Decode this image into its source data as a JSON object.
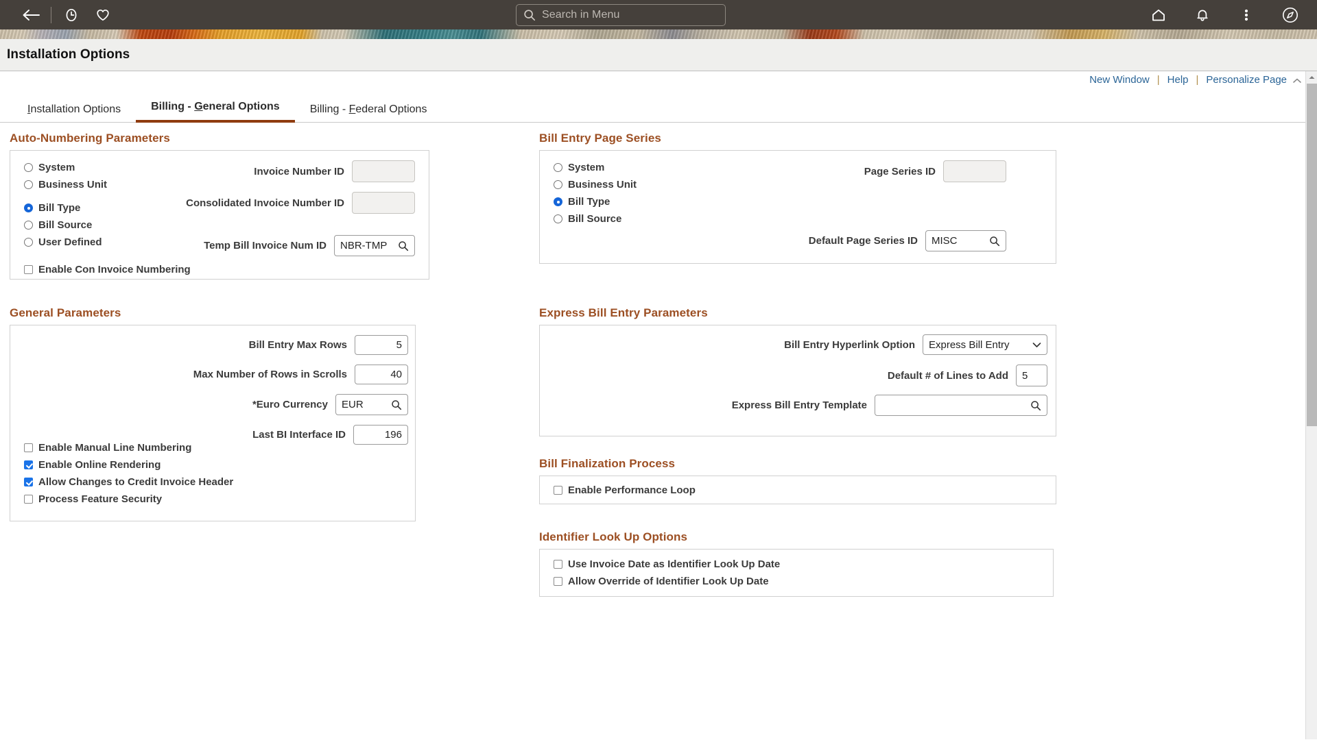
{
  "topbar": {
    "back_icon": "back-arrow-icon",
    "recent_icon": "clock-icon",
    "favorites_icon": "heart-icon",
    "home_icon": "home-icon",
    "notifications_icon": "bell-icon",
    "actions_icon": "kebab-menu-icon",
    "navbar_icon": "compass-icon",
    "search": {
      "placeholder": "Search in Menu",
      "value": "",
      "icon": "search-icon"
    },
    "background_color": "#45403b"
  },
  "page": {
    "title": "Installation Options"
  },
  "toolbar_links": {
    "new_window": "New Window",
    "help": "Help",
    "personalize": "Personalize Page",
    "separator": "|",
    "collapse_icon": "collapse-up-icon",
    "link_color": "#2a6496"
  },
  "tabs": [
    {
      "label": "Installation Options",
      "accel": "I",
      "active": false
    },
    {
      "label": "Billing - General Options",
      "accel": "G",
      "active": true
    },
    {
      "label": "Billing - Federal Options",
      "accel": "F",
      "active": false
    }
  ],
  "accent_color": "#9c4f23",
  "sections": {
    "auto_numbering": {
      "title": "Auto-Numbering Parameters",
      "radios": [
        {
          "label": "System",
          "checked": false
        },
        {
          "label": "Business Unit",
          "checked": false
        },
        {
          "label": "Bill Type",
          "checked": true
        },
        {
          "label": "Bill Source",
          "checked": false
        },
        {
          "label": "User Defined",
          "checked": false
        }
      ],
      "checkbox": {
        "label": "Enable Con Invoice Numbering",
        "checked": false
      },
      "fields": [
        {
          "label": "Invoice Number ID",
          "value": "",
          "disabled": true,
          "lookup": false
        },
        {
          "label": "Consolidated Invoice Number ID",
          "value": "",
          "disabled": true,
          "lookup": false
        },
        {
          "label": "Temp Bill Invoice Num ID",
          "value": "NBR-TMP",
          "disabled": false,
          "lookup": true
        }
      ]
    },
    "bill_entry_page_series": {
      "title": "Bill Entry Page Series",
      "radios": [
        {
          "label": "System",
          "checked": false
        },
        {
          "label": "Business Unit",
          "checked": false
        },
        {
          "label": "Bill Type",
          "checked": true
        },
        {
          "label": "Bill Source",
          "checked": false
        }
      ],
      "fields": [
        {
          "label": "Page Series ID",
          "value": "",
          "disabled": true,
          "lookup": false
        },
        {
          "label": "Default Page Series ID",
          "value": "MISC",
          "disabled": false,
          "lookup": true
        }
      ]
    },
    "general_parameters": {
      "title": "General Parameters",
      "fields": [
        {
          "label": "Bill Entry Max Rows",
          "value": "5",
          "type": "number",
          "lookup": false
        },
        {
          "label": "Max Number of Rows in Scrolls",
          "value": "40",
          "type": "number",
          "lookup": false
        },
        {
          "label": "*Euro Currency",
          "value": "EUR",
          "type": "text",
          "lookup": true
        },
        {
          "label": "Last BI Interface ID",
          "value": "196",
          "type": "number",
          "lookup": false
        }
      ],
      "checkboxes": [
        {
          "label": "Enable Manual Line Numbering",
          "checked": false
        },
        {
          "label": "Enable Online Rendering",
          "checked": true
        },
        {
          "label": "Allow Changes to Credit Invoice Header",
          "checked": true
        },
        {
          "label": "Process Feature Security",
          "checked": false
        }
      ]
    },
    "express_bill_entry": {
      "title": "Express Bill Entry Parameters",
      "hyperlink_option": {
        "label": "Bill Entry Hyperlink Option",
        "value": "Express Bill Entry"
      },
      "lines_to_add": {
        "label": "Default # of Lines to Add",
        "value": "5"
      },
      "template": {
        "label": "Express Bill Entry Template",
        "value": "",
        "lookup": true
      }
    },
    "bill_finalization": {
      "title": "Bill Finalization Process",
      "checkboxes": [
        {
          "label": "Enable Performance Loop",
          "checked": false
        }
      ]
    },
    "identifier_lookup": {
      "title": "Identifier Look Up Options",
      "checkboxes": [
        {
          "label": "Use Invoice Date as Identifier Look Up Date",
          "checked": false
        },
        {
          "label": "Allow Override of Identifier Look Up Date",
          "checked": false
        }
      ]
    }
  }
}
